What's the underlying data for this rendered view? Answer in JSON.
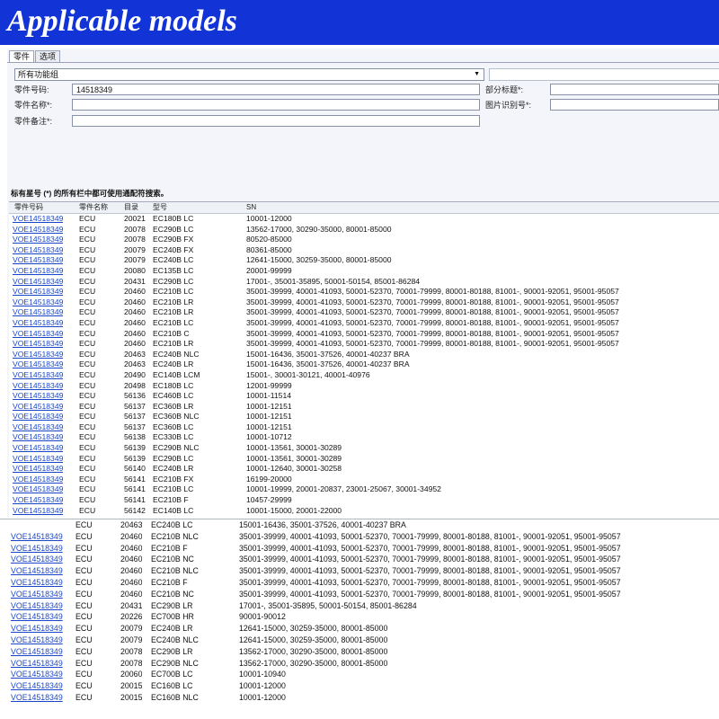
{
  "banner": {
    "title": "Applicable models"
  },
  "tabs": [
    {
      "label": "零件"
    },
    {
      "label": "选项"
    }
  ],
  "form": {
    "function_group": "所有功能组",
    "part_number_label": "零件号码:",
    "part_number_value": "14518349",
    "part_name_label": "零件名称*:",
    "part_note_label": "零件备注*:",
    "section_title_label": "部分标题*:",
    "image_id_label": "图片识别号*:",
    "hint": "标有星号 (*) 的所有栏中都可使用通配符搜索。"
  },
  "table": {
    "columns": [
      "零件号码",
      "零件名称",
      "目录",
      "型号",
      "SN"
    ],
    "rows": [
      [
        "VOE14518349",
        "ECU",
        "20021",
        "EC180B LC",
        "10001-12000"
      ],
      [
        "VOE14518349",
        "ECU",
        "20078",
        "EC290B LC",
        "13562-17000, 30290-35000, 80001-85000"
      ],
      [
        "VOE14518349",
        "ECU",
        "20078",
        "EC290B FX",
        "80520-85000"
      ],
      [
        "VOE14518349",
        "ECU",
        "20079",
        "EC240B FX",
        "80361-85000"
      ],
      [
        "VOE14518349",
        "ECU",
        "20079",
        "EC240B LC",
        "12641-15000, 30259-35000, 80001-85000"
      ],
      [
        "VOE14518349",
        "ECU",
        "20080",
        "EC135B LC",
        "20001-99999"
      ],
      [
        "VOE14518349",
        "ECU",
        "20431",
        "EC290B LC",
        "17001-, 35001-35895, 50001-50154, 85001-86284"
      ],
      [
        "VOE14518349",
        "ECU",
        "20460",
        "EC210B LC",
        "35001-39999, 40001-41093, 50001-52370, 70001-79999, 80001-80188, 81001-, 90001-92051, 95001-95057"
      ],
      [
        "VOE14518349",
        "ECU",
        "20460",
        "EC210B LR",
        "35001-39999, 40001-41093, 50001-52370, 70001-79999, 80001-80188, 81001-, 90001-92051, 95001-95057"
      ],
      [
        "VOE14518349",
        "ECU",
        "20460",
        "EC210B LR",
        "35001-39999, 40001-41093, 50001-52370, 70001-79999, 80001-80188, 81001-, 90001-92051, 95001-95057"
      ],
      [
        "VOE14518349",
        "ECU",
        "20460",
        "EC210B LC",
        "35001-39999, 40001-41093, 50001-52370, 70001-79999, 80001-80188, 81001-, 90001-92051, 95001-95057"
      ],
      [
        "VOE14518349",
        "ECU",
        "20460",
        "EC210B C",
        "35001-39999, 40001-41093, 50001-52370, 70001-79999, 80001-80188, 81001-, 90001-92051, 95001-95057"
      ],
      [
        "VOE14518349",
        "ECU",
        "20460",
        "EC210B LR",
        "35001-39999, 40001-41093, 50001-52370, 70001-79999, 80001-80188, 81001-, 90001-92051, 95001-95057"
      ],
      [
        "VOE14518349",
        "ECU",
        "20463",
        "EC240B NLC",
        "15001-16436, 35001-37526, 40001-40237 BRA"
      ],
      [
        "VOE14518349",
        "ECU",
        "20463",
        "EC240B LR",
        "15001-16436, 35001-37526, 40001-40237 BRA"
      ],
      [
        "VOE14518349",
        "ECU",
        "20490",
        "EC140B LCM",
        "15001-, 30001-30121, 40001-40976"
      ],
      [
        "VOE14518349",
        "ECU",
        "20498",
        "EC180B LC",
        "12001-99999"
      ],
      [
        "VOE14518349",
        "ECU",
        "56136",
        "EC460B LC",
        "10001-11514"
      ],
      [
        "VOE14518349",
        "ECU",
        "56137",
        "EC360B LR",
        "10001-12151"
      ],
      [
        "VOE14518349",
        "ECU",
        "56137",
        "EC360B NLC",
        "10001-12151"
      ],
      [
        "VOE14518349",
        "ECU",
        "56137",
        "EC360B LC",
        "10001-12151"
      ],
      [
        "VOE14518349",
        "ECU",
        "56138",
        "EC330B LC",
        "10001-10712"
      ],
      [
        "VOE14518349",
        "ECU",
        "56139",
        "EC290B NLC",
        "10001-13561, 30001-30289"
      ],
      [
        "VOE14518349",
        "ECU",
        "56139",
        "EC290B LC",
        "10001-13561, 30001-30289"
      ],
      [
        "VOE14518349",
        "ECU",
        "56140",
        "EC240B LR",
        "10001-12640, 30001-30258"
      ],
      [
        "VOE14518349",
        "ECU",
        "56141",
        "EC210B FX",
        "16199-20000"
      ],
      [
        "VOE14518349",
        "ECU",
        "56141",
        "EC210B LC",
        "10001-19999, 20001-20837, 23001-25067, 30001-34952"
      ],
      [
        "VOE14518349",
        "ECU",
        "56141",
        "EC210B F",
        "10457-29999"
      ],
      [
        "VOE14518349",
        "ECU",
        "56142",
        "EC140B LC",
        "10001-15000, 20001-22000"
      ]
    ]
  },
  "table2": {
    "rows": [
      [
        "",
        "ECU",
        "20463",
        "EC240B LC",
        "15001-16436, 35001-37526, 40001-40237 BRA"
      ],
      [
        "VOE14518349",
        "ECU",
        "20460",
        "EC210B NLC",
        "35001-39999, 40001-41093, 50001-52370, 70001-79999, 80001-80188, 81001-, 90001-92051, 95001-95057"
      ],
      [
        "VOE14518349",
        "ECU",
        "20460",
        "EC210B F",
        "35001-39999, 40001-41093, 50001-52370, 70001-79999, 80001-80188, 81001-, 90001-92051, 95001-95057"
      ],
      [
        "VOE14518349",
        "ECU",
        "20460",
        "EC210B NC",
        "35001-39999, 40001-41093, 50001-52370, 70001-79999, 80001-80188, 81001-, 90001-92051, 95001-95057"
      ],
      [
        "VOE14518349",
        "ECU",
        "20460",
        "EC210B NLC",
        "35001-39999, 40001-41093, 50001-52370, 70001-79999, 80001-80188, 81001-, 90001-92051, 95001-95057"
      ],
      [
        "VOE14518349",
        "ECU",
        "20460",
        "EC210B F",
        "35001-39999, 40001-41093, 50001-52370, 70001-79999, 80001-80188, 81001-, 90001-92051, 95001-95057"
      ],
      [
        "VOE14518349",
        "ECU",
        "20460",
        "EC210B NC",
        "35001-39999, 40001-41093, 50001-52370, 70001-79999, 80001-80188, 81001-, 90001-92051, 95001-95057"
      ],
      [
        "VOE14518349",
        "ECU",
        "20431",
        "EC290B LR",
        "17001-, 35001-35895, 50001-50154, 85001-86284"
      ],
      [
        "VOE14518349",
        "ECU",
        "20226",
        "EC700B HR",
        "90001-90012"
      ],
      [
        "VOE14518349",
        "ECU",
        "20079",
        "EC240B LR",
        "12641-15000, 30259-35000, 80001-85000"
      ],
      [
        "VOE14518349",
        "ECU",
        "20079",
        "EC240B NLC",
        "12641-15000, 30259-35000, 80001-85000"
      ],
      [
        "VOE14518349",
        "ECU",
        "20078",
        "EC290B LR",
        "13562-17000, 30290-35000, 80001-85000"
      ],
      [
        "VOE14518349",
        "ECU",
        "20078",
        "EC290B NLC",
        "13562-17000, 30290-35000, 80001-85000"
      ],
      [
        "VOE14518349",
        "ECU",
        "20060",
        "EC700B LC",
        "10001-10940"
      ],
      [
        "VOE14518349",
        "ECU",
        "20015",
        "EC160B LC",
        "10001-12000"
      ],
      [
        "VOE14518349",
        "ECU",
        "20015",
        "EC160B NLC",
        "10001-12000"
      ]
    ]
  }
}
